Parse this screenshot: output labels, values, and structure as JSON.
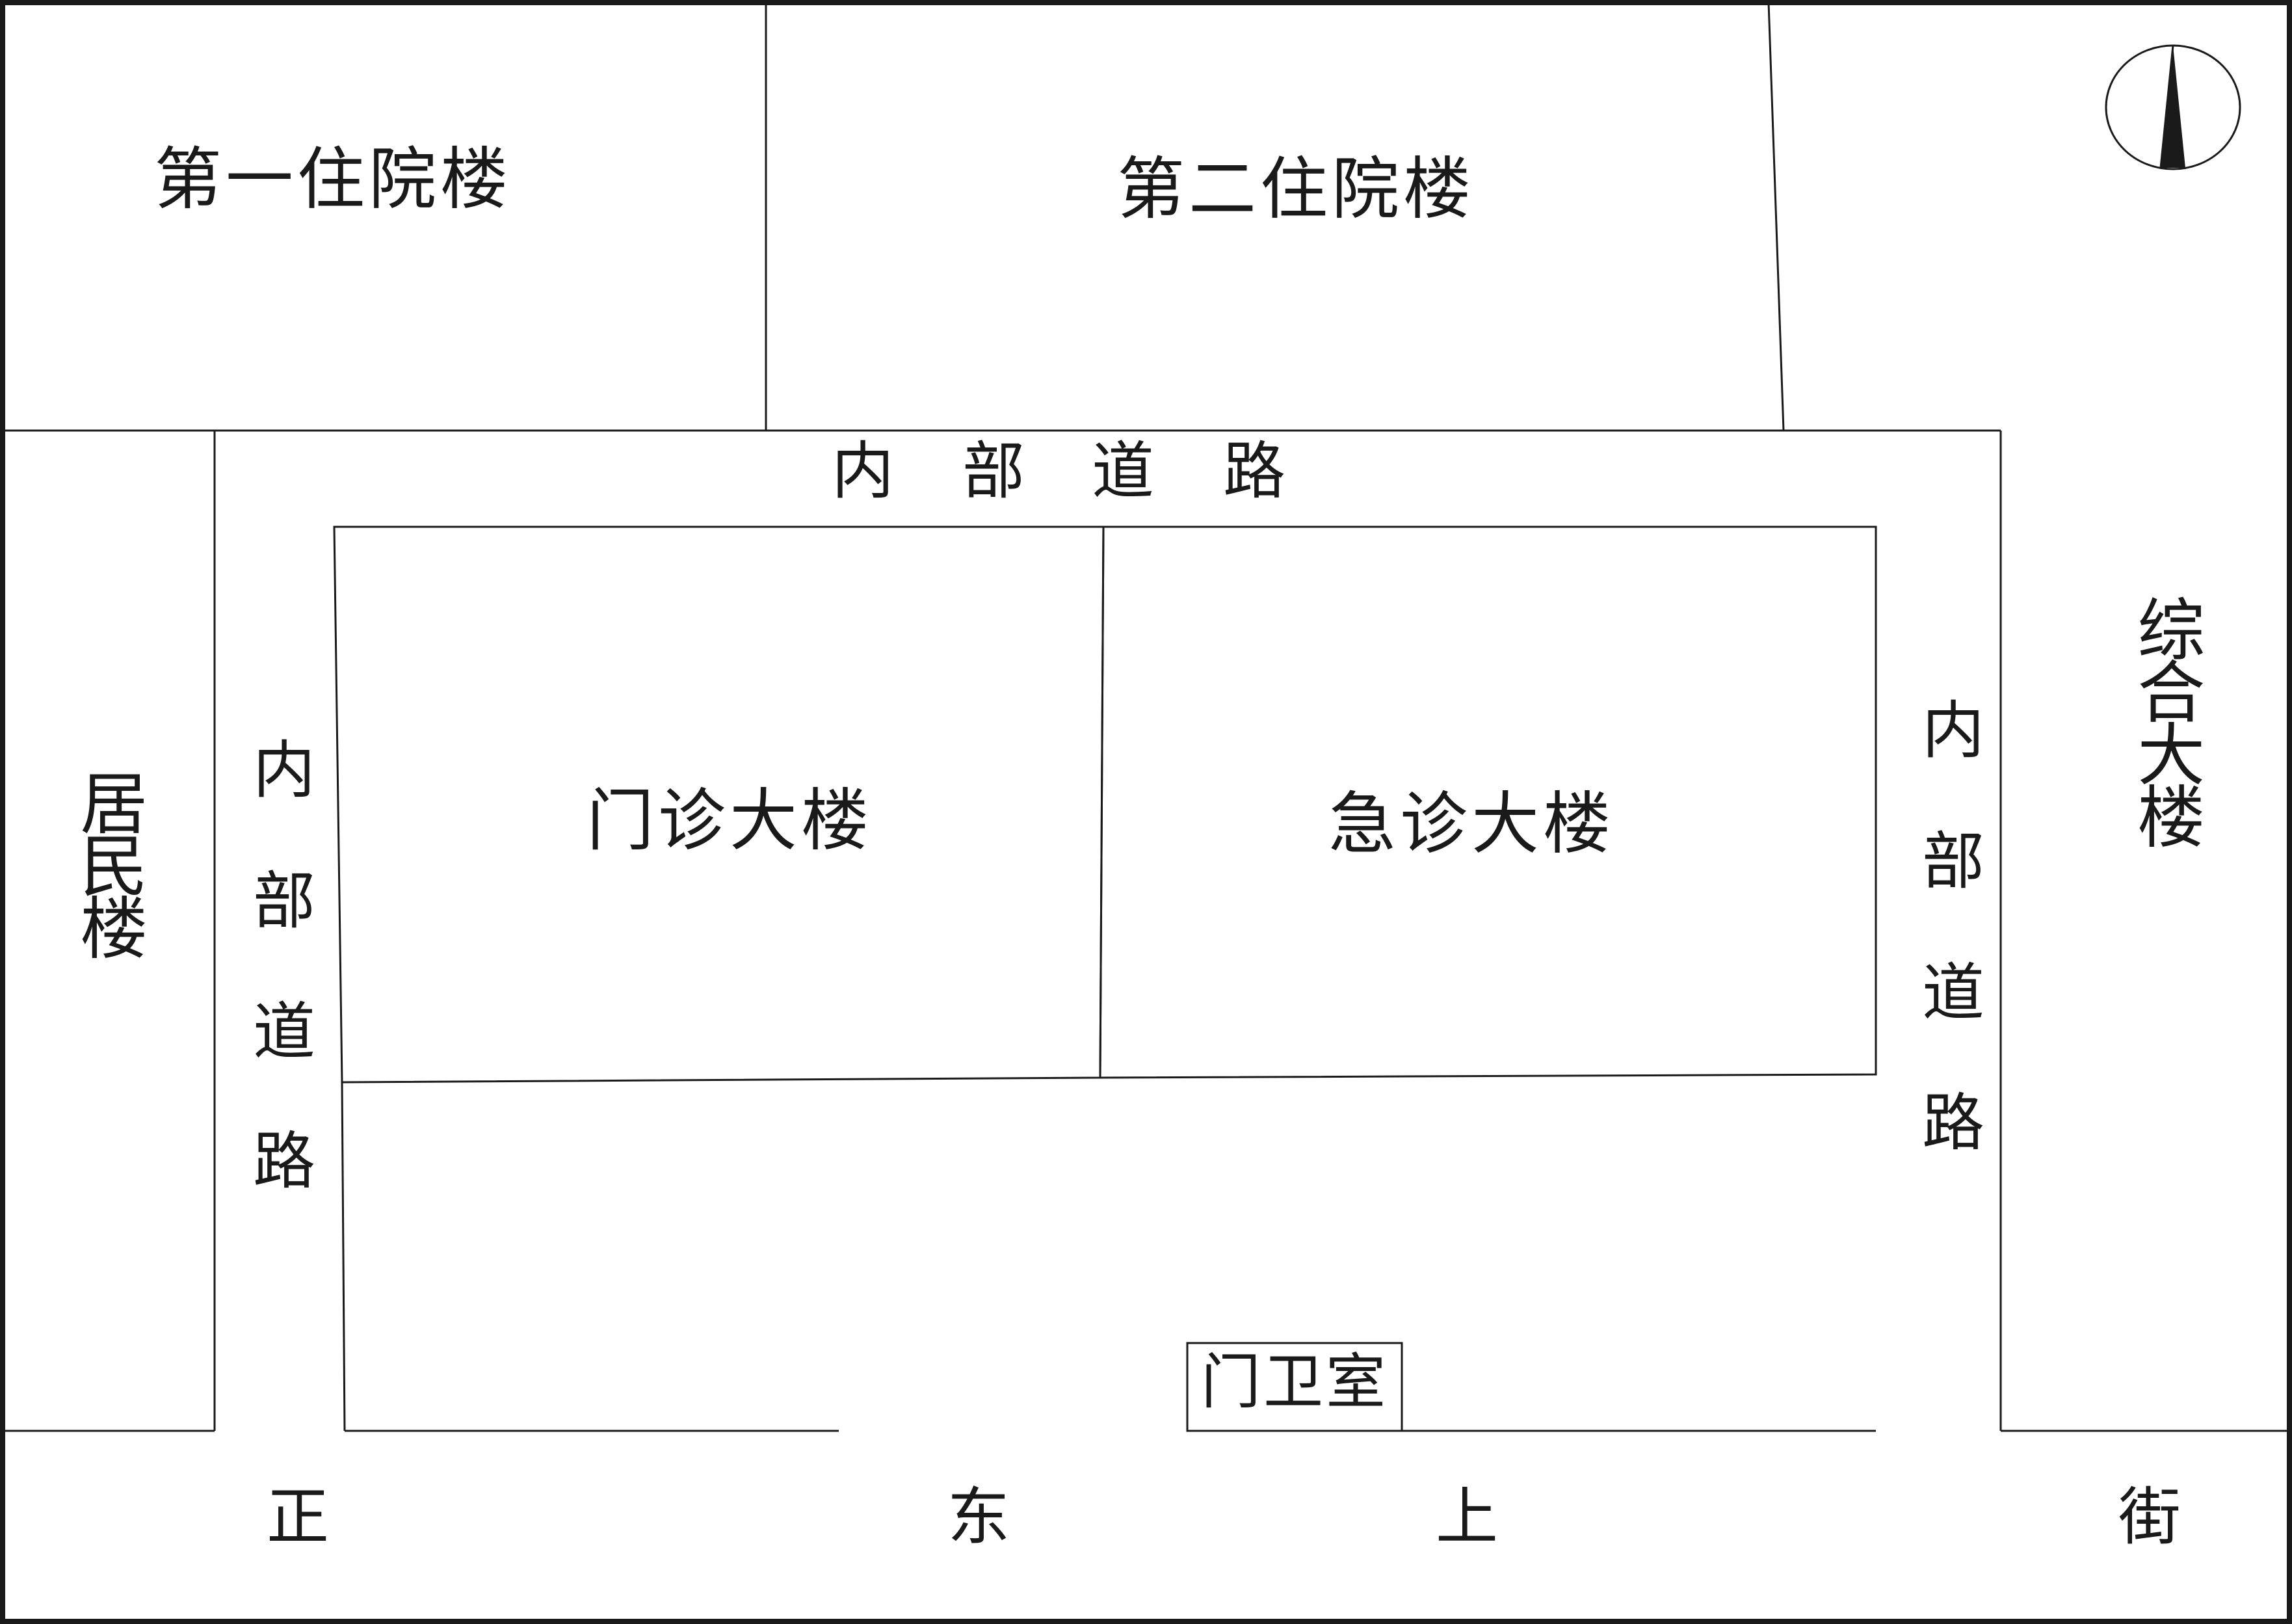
{
  "buildings": {
    "inpatient_1": "第一住院楼",
    "inpatient_2": "第二住院楼",
    "outpatient": "门诊大楼",
    "emergency": "急诊大楼",
    "complex": "综合大楼",
    "residential": "居民楼",
    "guard_room": "门卫室"
  },
  "roads": {
    "internal_top": [
      "内",
      "部",
      "道",
      "路"
    ],
    "internal_left": [
      "内",
      "部",
      "道",
      "路"
    ],
    "internal_right": [
      "内",
      "部",
      "道",
      "路"
    ],
    "street": [
      "正",
      "东",
      "上",
      "街"
    ]
  },
  "compass": {
    "icon": "north-arrow-icon"
  },
  "colors": {
    "line": "#1a1a1a",
    "background": "#ffffff"
  }
}
